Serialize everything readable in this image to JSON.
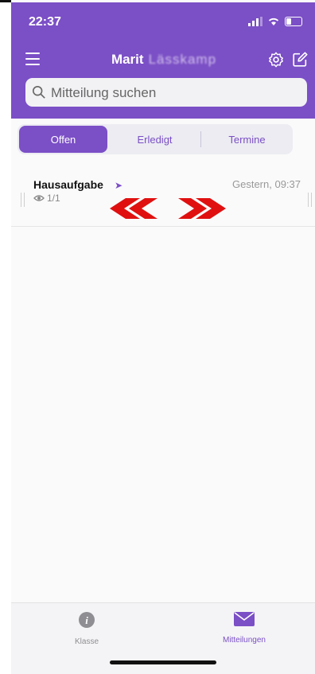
{
  "status": {
    "time": "22:37"
  },
  "header": {
    "title_name": "Marit",
    "title_blurred": "Lässkamp",
    "search_placeholder": "Mitteilung suchen"
  },
  "tabs": [
    {
      "label": "Offen",
      "active": true
    },
    {
      "label": "Erledigt",
      "active": false
    },
    {
      "label": "Termine",
      "active": false
    }
  ],
  "messages": [
    {
      "title": "Hausaufgabe",
      "time": "Gestern, 09:37",
      "views": "1/1"
    }
  ],
  "tabbar": [
    {
      "label": "Klasse",
      "icon": "info-icon",
      "active": false
    },
    {
      "label": "Mitteilungen",
      "icon": "envelope-icon",
      "active": true
    }
  ],
  "colors": {
    "accent": "#7b4fc6",
    "swipe_arrows": "#e01010"
  }
}
